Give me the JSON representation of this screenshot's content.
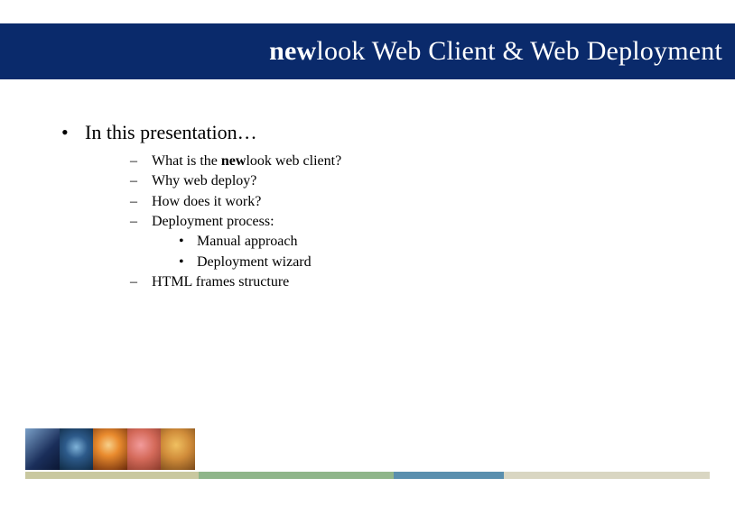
{
  "title": {
    "bold_prefix": "new",
    "rest": "look Web Client & Web Deployment"
  },
  "content": {
    "lvl1": "In this presentation…",
    "items": [
      {
        "type": "lvl2_rich",
        "prefix": "What is the ",
        "bold": "new",
        "suffix": "look web client?"
      },
      {
        "type": "lvl2",
        "text": "Why web deploy?"
      },
      {
        "type": "lvl2",
        "text": "How does it work?"
      },
      {
        "type": "lvl2",
        "text": "Deployment process:",
        "children": [
          {
            "text": "Manual approach"
          },
          {
            "text": "Deployment wizard"
          }
        ]
      },
      {
        "type": "lvl2",
        "text": "HTML frames structure"
      }
    ]
  }
}
